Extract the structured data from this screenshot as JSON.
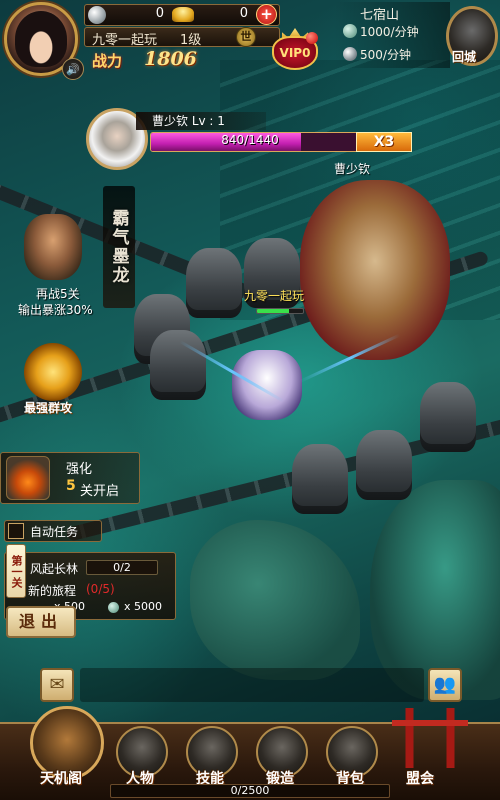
{
  "player": {
    "silver": "0",
    "gold": "0",
    "name": "九零一起玩",
    "level": "1级",
    "world_badge": "世",
    "power_label": "战力",
    "power_value": "1806",
    "vip_label": "VIP0"
  },
  "stage": {
    "name": "七宿山",
    "rate_a": "1000/分钟",
    "rate_b": "500/分钟",
    "city_label": "回城"
  },
  "boss": {
    "title": "曹少钦 Lv : 1",
    "hp_text": "840/1440",
    "hp_fraction": 0.583,
    "hp_multiplier": "X3",
    "scene_tag": "曹少钦"
  },
  "hero": {
    "scene_tag": "九零一起玩",
    "hp_fraction": 0.7
  },
  "events": {
    "banner": "霸气墨龙",
    "event1_line1": "再战5关",
    "event1_line2": "输出暴涨30%",
    "event2_label": "最强群攻",
    "forge_title": "强化",
    "forge_num": "5",
    "forge_sub": "关开启"
  },
  "quest": {
    "auto_label": "自动任务",
    "chapter_tag": "第一关",
    "stage_name": "风起长林",
    "progress": "0/2",
    "quest_name": "新的旅程",
    "quest_count": "(0/5)",
    "reward_a": "x 500",
    "reward_b": "x 5000",
    "exit_label": "退出"
  },
  "menu": {
    "items": [
      {
        "label": "天机阁"
      },
      {
        "label": "人物"
      },
      {
        "label": "技能"
      },
      {
        "label": "锻造"
      },
      {
        "label": "背包"
      },
      {
        "label": "盟会"
      }
    ],
    "exp_text": "0/2500"
  },
  "colors": {
    "hp": "#c21fb0",
    "gold_text": "#ffc640",
    "quest_red": "#e02a2a"
  }
}
